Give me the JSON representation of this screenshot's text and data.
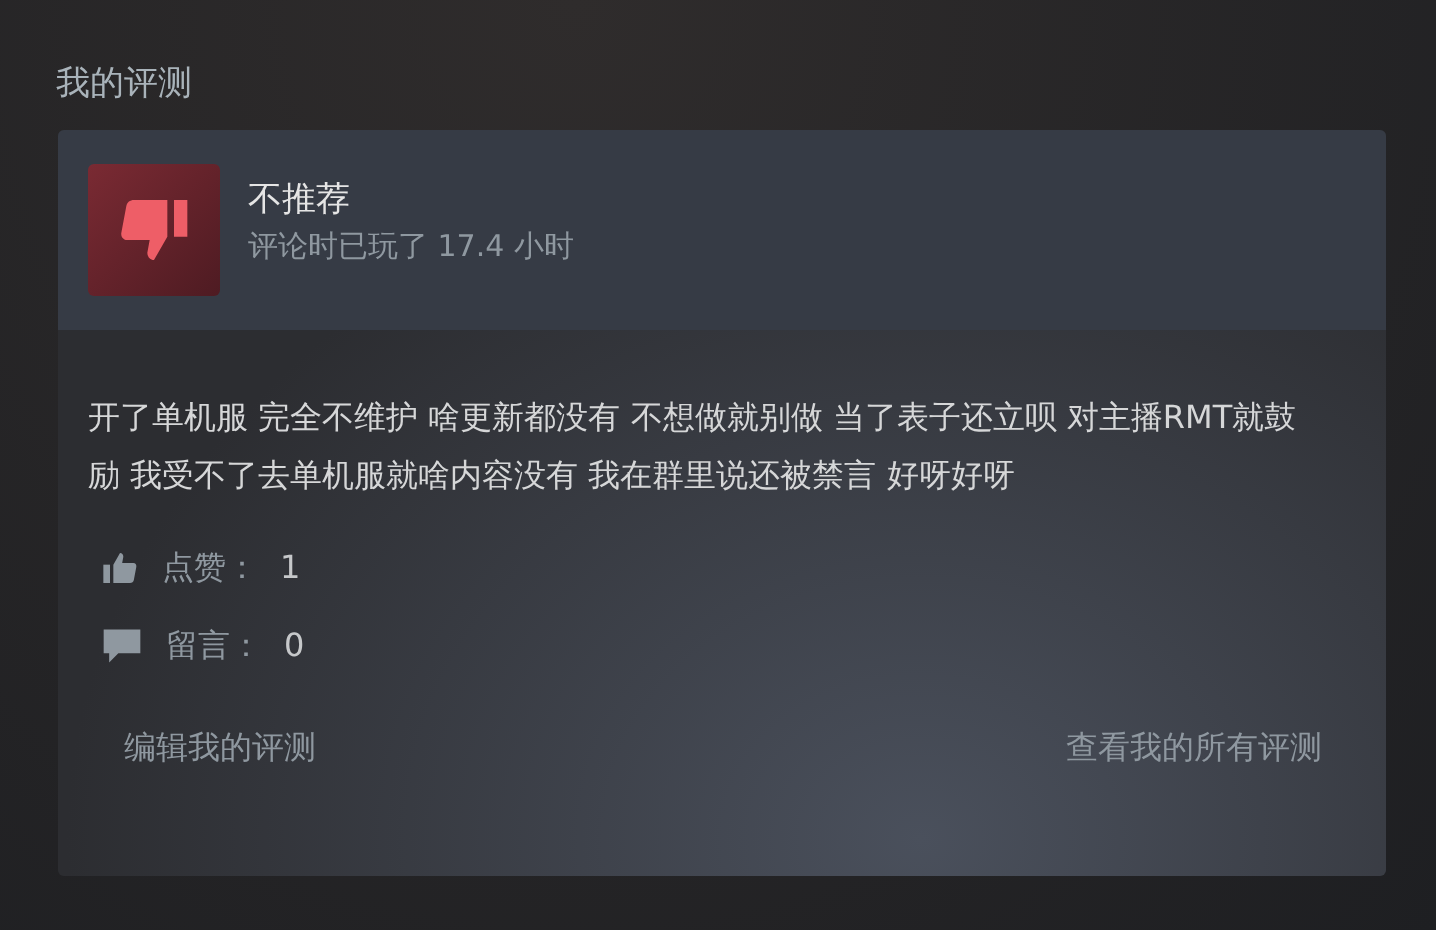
{
  "section_title": "我的评测",
  "review": {
    "verdict": "不推荐",
    "recommended": false,
    "playtime": "评论时已玩了 17.4 小时",
    "text": "开了单机服 完全不维护 啥更新都没有 不想做就别做 当了表子还立呗 对主播RMT就鼓励 我受不了去单机服就啥内容没有 我在群里说还被禁言 好呀好呀",
    "stats": [
      {
        "kind": "likes",
        "label": "点赞：",
        "value": "1"
      },
      {
        "kind": "comments",
        "label": "留言：",
        "value": "0"
      }
    ],
    "links": [
      "编辑我的评测",
      "查看我的所有评测"
    ]
  }
}
